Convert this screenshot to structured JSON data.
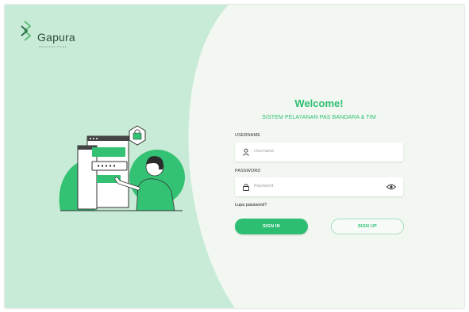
{
  "brand": {
    "name": "Gapura",
    "tagline": "ANGKASA PURA"
  },
  "welcome": {
    "title": "Welcome!",
    "subtitle": "SISTEM PELAYANAN PAS BANDARA & TIM"
  },
  "form": {
    "username": {
      "label": "USERNAME",
      "placeholder": "Username",
      "icon": "user-icon"
    },
    "password": {
      "label": "PASSWORD",
      "placeholder": "Password",
      "icon": "lock-icon",
      "toggle_icon": "eye-icon"
    },
    "forgot_label": "Lupa password?",
    "signin_label": "SIGN IN",
    "signup_label": "SIGN UP"
  },
  "colors": {
    "accent": "#2dbe72",
    "shape": "#c7ebd6",
    "background": "#f2f7f2"
  }
}
